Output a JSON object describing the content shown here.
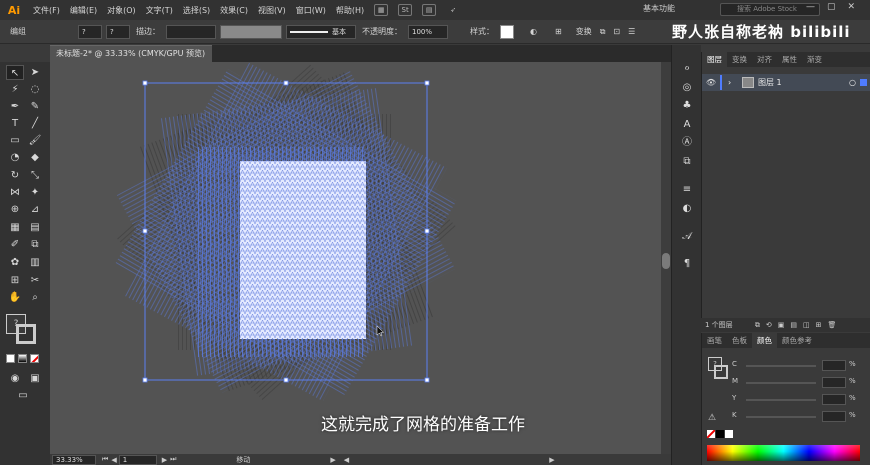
{
  "app": {
    "logo": "Ai"
  },
  "menubar": {
    "items": [
      "文件(F)",
      "编辑(E)",
      "对象(O)",
      "文字(T)",
      "选择(S)",
      "效果(C)",
      "视图(V)",
      "窗口(W)",
      "帮助(H)"
    ],
    "st_icon": "St",
    "workspace": "基本功能",
    "stock_placeholder": "搜索 Adobe Stock",
    "window_controls": [
      "—",
      "▢",
      "✕"
    ]
  },
  "watermark": {
    "text": "野人张自称老衲 bilibili"
  },
  "controlbar": {
    "left_label": "编组",
    "stroke_label": "描边：",
    "stroke_style": "基本",
    "opacity_label": "不透明度：",
    "opacity_value": "100%",
    "style_label": "样式：",
    "transform_label": "变换"
  },
  "document": {
    "tab_title": "未标题-2* @ 33.33% (CMYK/GPU 预览)",
    "tab_close": "✕"
  },
  "statusbar": {
    "zoom": "33.33%",
    "artboard": "1",
    "tool_status": "移动"
  },
  "layers_panel": {
    "tabs": [
      "图层",
      "变换",
      "对齐",
      "属性",
      "渐变"
    ],
    "layer_name": "图层 1",
    "layer_count": "1 个图层"
  },
  "color_panel": {
    "tabs": [
      "画笔",
      "色板",
      "颜色",
      "颜色参考"
    ],
    "channels": [
      "C",
      "M",
      "Y",
      "K"
    ],
    "unit": "%"
  },
  "subtitle": {
    "text": "这就完成了网格的准备工作"
  },
  "colors": {
    "accent": "#ff9a00",
    "selection": "#4a6cd4",
    "canvas": "#535353"
  }
}
